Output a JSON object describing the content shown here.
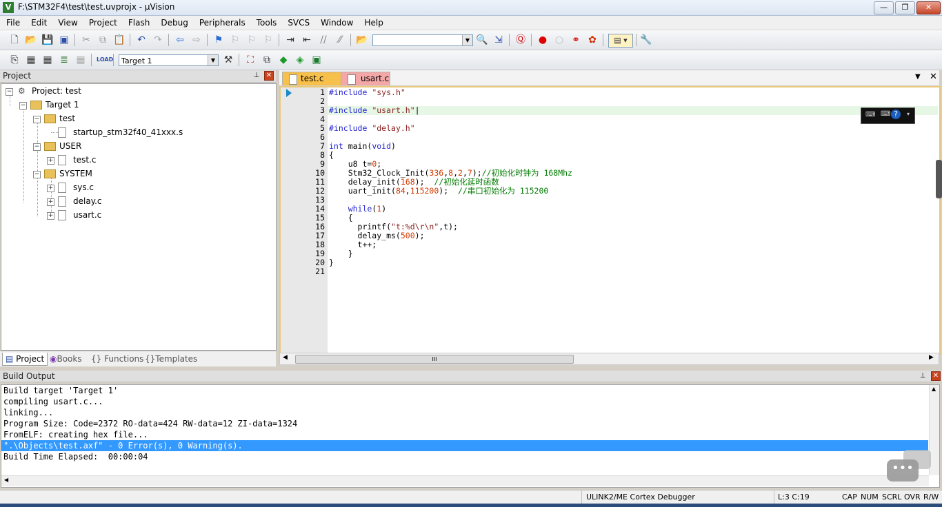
{
  "window": {
    "title": "F:\\STM32F4\\test\\test.uvprojx - µVision",
    "app_icon_letter": "V",
    "minimize": "—",
    "maximize": "❐",
    "close": "✕"
  },
  "menu": [
    "File",
    "Edit",
    "View",
    "Project",
    "Flash",
    "Debug",
    "Peripherals",
    "Tools",
    "SVCS",
    "Window",
    "Help"
  ],
  "toolbar2": {
    "target_select": "Target 1"
  },
  "project_panel": {
    "title": "Project",
    "root": "Project: test",
    "target": "Target 1",
    "groups": [
      {
        "name": "test",
        "files": [
          "startup_stm32f40_41xxx.s"
        ]
      },
      {
        "name": "USER",
        "files": [
          "test.c"
        ]
      },
      {
        "name": "SYSTEM",
        "files": [
          "sys.c",
          "delay.c",
          "usart.c"
        ]
      }
    ],
    "tabs": [
      "Project",
      "Books",
      "Functions",
      "Templates"
    ]
  },
  "editor": {
    "tabs": [
      {
        "label": "test.c",
        "active": true
      },
      {
        "label": "usart.c",
        "active": false
      }
    ],
    "current_line": 3,
    "scroll_marker": "III"
  },
  "build_output": {
    "title": "Build Output",
    "lines": [
      "Build target 'Target 1'",
      "compiling usart.c...",
      "linking...",
      "Program Size: Code=2372 RO-data=424 RW-data=12 ZI-data=1324",
      "FromELF: creating hex file...",
      "\".\\Objects\\test.axf\" - 0 Error(s), 0 Warning(s).",
      "Build Time Elapsed:  00:00:04"
    ],
    "highlighted_line": 5
  },
  "status": {
    "debugger": "ULINK2/ME Cortex Debugger",
    "position": "L:3 C:19",
    "cap": "CAP",
    "num": "NUM",
    "scrl": "SCRL",
    "ovr": "OVR",
    "rw": "R/W"
  },
  "colors": {
    "accent_highlight": "#3399ff",
    "active_tab": "#f7c04a",
    "inactive_tab": "#f3a7a7"
  }
}
